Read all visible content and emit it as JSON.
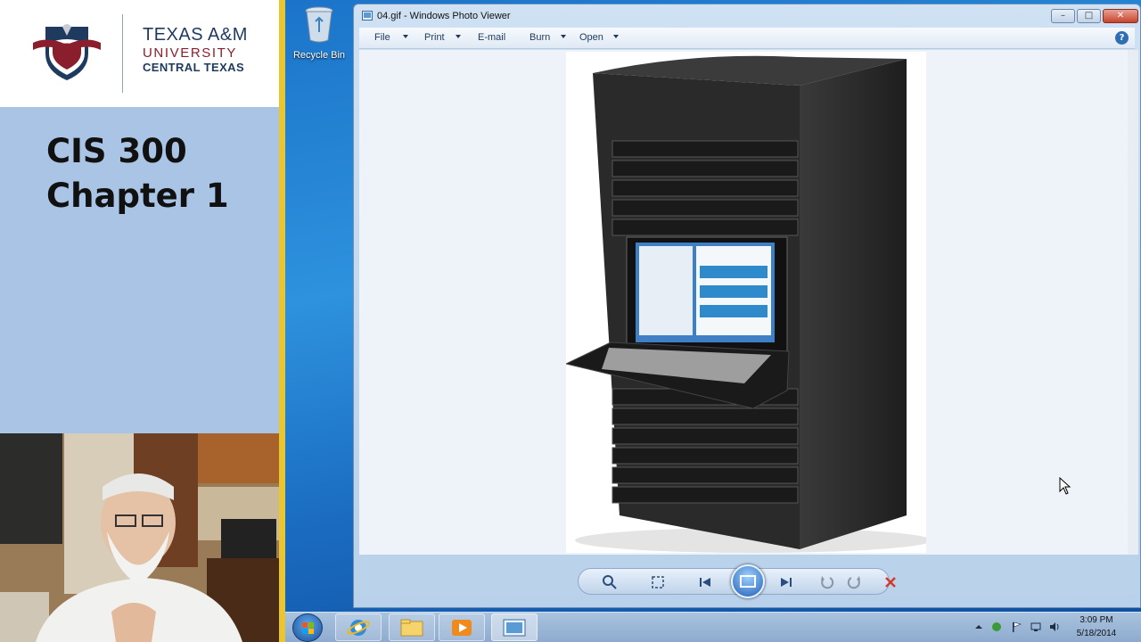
{
  "slide": {
    "logo": {
      "line1": "TEXAS A&M",
      "line2": "UNIVERSITY",
      "line3": "CENTRAL TEXAS"
    },
    "title_line1": "CIS 300",
    "title_line2": "Chapter 1"
  },
  "desktop": {
    "recycle_bin_label": "Recycle Bin"
  },
  "window": {
    "title": "04.gif - Windows Photo Viewer",
    "menu": [
      {
        "label": "File",
        "has_dropdown": true
      },
      {
        "label": "Print",
        "has_dropdown": true
      },
      {
        "label": "E-mail",
        "has_dropdown": false
      },
      {
        "label": "Burn",
        "has_dropdown": true
      },
      {
        "label": "Open",
        "has_dropdown": true
      }
    ],
    "help_label": "?",
    "controls": [
      "zoom-icon",
      "actual-size-icon",
      "previous-icon",
      "slideshow-icon",
      "next-icon",
      "rotate-counterclockwise-icon",
      "rotate-clockwise-icon",
      "delete-icon"
    ]
  },
  "taskbar": {
    "pinned": [
      "internet-explorer-icon",
      "windows-explorer-icon",
      "media-player-icon",
      "photo-viewer-icon"
    ],
    "time": "3:09 PM",
    "date": "5/18/2014"
  },
  "colors": {
    "accent_red": "#d3392b",
    "slide_bg": "#a9c4e4",
    "brand_navy": "#1f3a5f",
    "brand_maroon": "#8a1e2c"
  }
}
